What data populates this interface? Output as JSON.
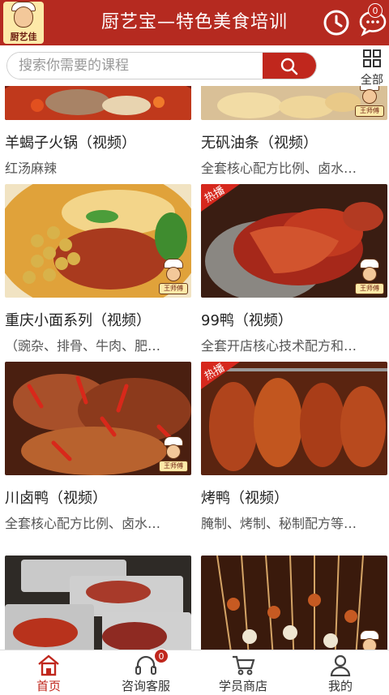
{
  "header": {
    "title": "厨艺宝—特色美食培训",
    "logo_text": "厨艺佳",
    "chat_badge": "0",
    "brand_color": "#b52a20"
  },
  "search": {
    "placeholder": "搜索你需要的课程",
    "all_label": "全部"
  },
  "courses": [
    {
      "title": "羊蝎子火锅（视频）",
      "subtitle": "红汤麻辣",
      "hot": false
    },
    {
      "title": "无矾油条（视频）",
      "subtitle": "全套核心配方比例、卤水…",
      "hot": false
    },
    {
      "title": "重庆小面系列（视频）",
      "subtitle": "（豌杂、排骨、牛肉、肥…",
      "hot": false
    },
    {
      "title": "99鸭（视频）",
      "subtitle": "全套开店核心技术配方和…",
      "hot": true,
      "hot_label": "热播"
    },
    {
      "title": "川卤鸭（视频）",
      "subtitle": "全套核心配方比例、卤水…",
      "hot": false
    },
    {
      "title": "烤鸭（视频）",
      "subtitle": "腌制、烤制、秘制配方等…",
      "hot": true,
      "hot_label": "热播"
    },
    {
      "title": "",
      "subtitle": "",
      "hot": false
    },
    {
      "title": "",
      "subtitle": "",
      "hot": false
    }
  ],
  "mascot_label": "王师傅",
  "bottom_nav": [
    {
      "label": "首页",
      "icon": "home-icon",
      "active": true
    },
    {
      "label": "咨询客服",
      "icon": "headset-icon",
      "badge": "0"
    },
    {
      "label": "学员商店",
      "icon": "cart-icon"
    },
    {
      "label": "我的",
      "icon": "user-icon"
    }
  ]
}
